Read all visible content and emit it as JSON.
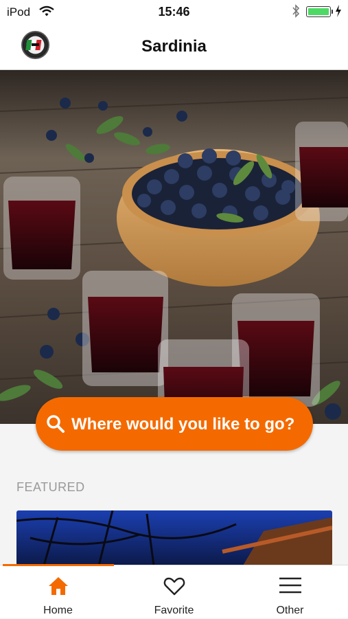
{
  "status_bar": {
    "carrier": "iPod",
    "time": "15:46",
    "battery_color": "#4cd964"
  },
  "nav": {
    "title": "Sardinia",
    "logo_icon": "italy-flag-badge-icon"
  },
  "search": {
    "label": "Where would you like to go?",
    "icon": "search-icon",
    "color": "#f46a00"
  },
  "featured": {
    "heading": "FEATURED"
  },
  "tabs": [
    {
      "label": "Home",
      "icon": "home-icon",
      "active": true
    },
    {
      "label": "Favorite",
      "icon": "heart-icon",
      "active": false
    },
    {
      "label": "Other",
      "icon": "menu-icon",
      "active": false
    }
  ],
  "accent_color": "#f46a00"
}
